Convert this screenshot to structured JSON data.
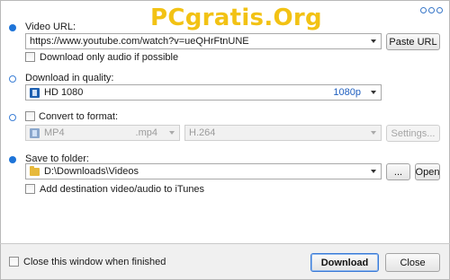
{
  "watermark": "PCgratis.Org",
  "video_url": {
    "label": "Video URL:",
    "value": "https://www.youtube.com/watch?v=ueQHrFtnUNE",
    "paste_button": "Paste URL",
    "audio_only_label": "Download only audio if possible"
  },
  "quality": {
    "label": "Download in quality:",
    "value": "HD 1080",
    "resolution": "1080p",
    "resolution_color": "#1f5fbf"
  },
  "convert": {
    "label": "Convert to format:",
    "format": "MP4",
    "extension": ".mp4",
    "codec": "H.264",
    "settings_button": "Settings..."
  },
  "folder": {
    "label": "Save to folder:",
    "path": "D:\\Downloads\\Videos",
    "browse_button": "...",
    "open_button": "Open",
    "itunes_label": "Add destination video/audio to iTunes"
  },
  "footer": {
    "close_when_finished": "Close this window when finished",
    "download_button": "Download",
    "close_button": "Close"
  },
  "colors": {
    "accent": "#1e74d8",
    "watermark": "#f2c214"
  }
}
